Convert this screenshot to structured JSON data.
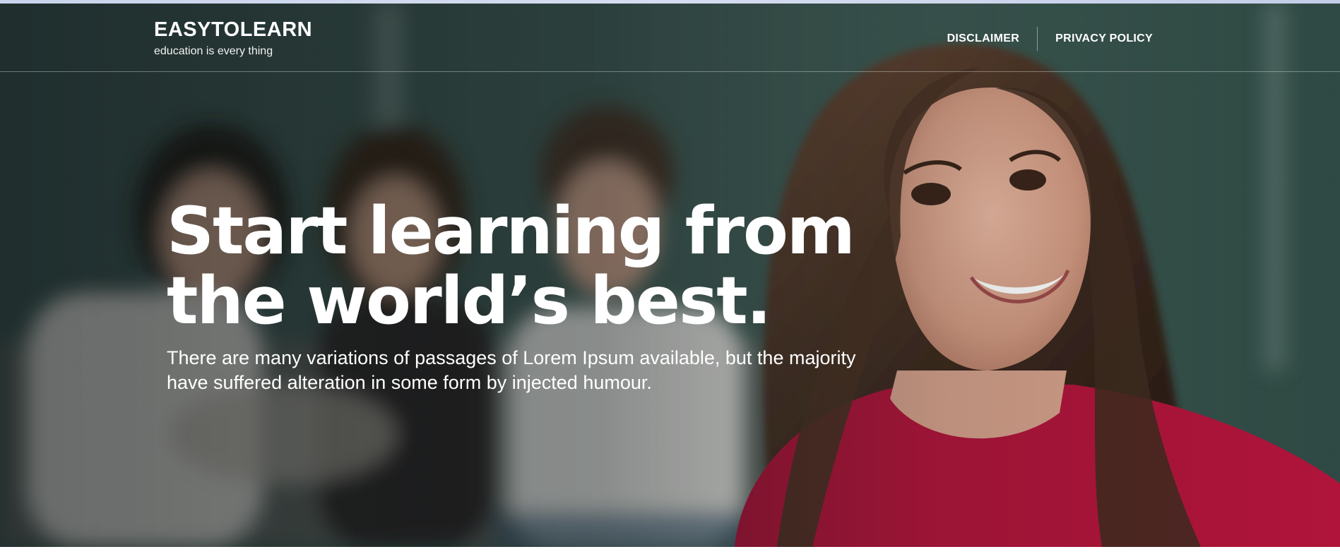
{
  "header": {
    "brand_title": "EASYTOLEARN",
    "brand_tagline": "education is every thing",
    "nav": [
      {
        "label": "DISCLAIMER"
      },
      {
        "label": "PRIVACY POLICY"
      }
    ]
  },
  "hero": {
    "headline_line1": "Start learning from",
    "headline_line2": "the world’s best.",
    "subtext": "There are many variations of passages of Lorem Ipsum available, but the majority have suffered alteration in some form by injected humour."
  },
  "colors": {
    "text": "#ffffff",
    "hero_dark": "#2b3b38",
    "shirt_red": "#b0143a"
  }
}
